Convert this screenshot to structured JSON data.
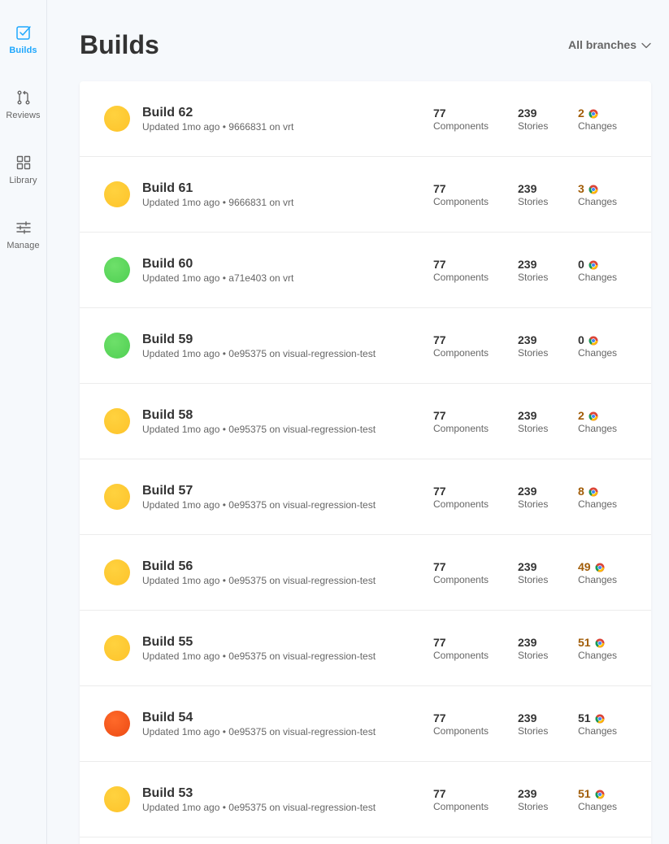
{
  "sidebar": {
    "items": [
      {
        "label": "Builds",
        "icon": "builds-checkbox-icon",
        "active": true
      },
      {
        "label": "Reviews",
        "icon": "pull-request-icon",
        "active": false
      },
      {
        "label": "Library",
        "icon": "grid-icon",
        "active": false
      },
      {
        "label": "Manage",
        "icon": "sliders-icon",
        "active": false
      }
    ]
  },
  "header": {
    "title": "Builds",
    "branch_filter": "All branches"
  },
  "colors": {
    "accent": "#1ea7fd",
    "pending": "#ffc62e",
    "passed": "#5dd35f",
    "failed": "#f4511e",
    "changes_pending": "#a15c07"
  },
  "builds": [
    {
      "name": "Build 62",
      "subtitle": "Updated 1mo ago • 9666831 on vrt",
      "status": "pending",
      "components": "77",
      "components_label": "Components",
      "stories": "239",
      "stories_label": "Stories",
      "changes": "2",
      "changes_label": "Changes",
      "changes_highlight": true
    },
    {
      "name": "Build 61",
      "subtitle": "Updated 1mo ago • 9666831 on vrt",
      "status": "pending",
      "components": "77",
      "components_label": "Components",
      "stories": "239",
      "stories_label": "Stories",
      "changes": "3",
      "changes_label": "Changes",
      "changes_highlight": true
    },
    {
      "name": "Build 60",
      "subtitle": "Updated 1mo ago • a71e403 on vrt",
      "status": "passed",
      "components": "77",
      "components_label": "Components",
      "stories": "239",
      "stories_label": "Stories",
      "changes": "0",
      "changes_label": "Changes",
      "changes_highlight": false
    },
    {
      "name": "Build 59",
      "subtitle": "Updated 1mo ago • 0e95375 on visual-regression-test",
      "status": "passed",
      "components": "77",
      "components_label": "Components",
      "stories": "239",
      "stories_label": "Stories",
      "changes": "0",
      "changes_label": "Changes",
      "changes_highlight": false
    },
    {
      "name": "Build 58",
      "subtitle": "Updated 1mo ago • 0e95375 on visual-regression-test",
      "status": "pending",
      "components": "77",
      "components_label": "Components",
      "stories": "239",
      "stories_label": "Stories",
      "changes": "2",
      "changes_label": "Changes",
      "changes_highlight": true
    },
    {
      "name": "Build 57",
      "subtitle": "Updated 1mo ago • 0e95375 on visual-regression-test",
      "status": "pending",
      "components": "77",
      "components_label": "Components",
      "stories": "239",
      "stories_label": "Stories",
      "changes": "8",
      "changes_label": "Changes",
      "changes_highlight": true
    },
    {
      "name": "Build 56",
      "subtitle": "Updated 1mo ago • 0e95375 on visual-regression-test",
      "status": "pending",
      "components": "77",
      "components_label": "Components",
      "stories": "239",
      "stories_label": "Stories",
      "changes": "49",
      "changes_label": "Changes",
      "changes_highlight": true
    },
    {
      "name": "Build 55",
      "subtitle": "Updated 1mo ago • 0e95375 on visual-regression-test",
      "status": "pending",
      "components": "77",
      "components_label": "Components",
      "stories": "239",
      "stories_label": "Stories",
      "changes": "51",
      "changes_label": "Changes",
      "changes_highlight": true
    },
    {
      "name": "Build 54",
      "subtitle": "Updated 1mo ago • 0e95375 on visual-regression-test",
      "status": "failed",
      "components": "77",
      "components_label": "Components",
      "stories": "239",
      "stories_label": "Stories",
      "changes": "51",
      "changes_label": "Changes",
      "changes_highlight": false
    },
    {
      "name": "Build 53",
      "subtitle": "Updated 1mo ago • 0e95375 on visual-regression-test",
      "status": "pending",
      "components": "77",
      "components_label": "Components",
      "stories": "239",
      "stories_label": "Stories",
      "changes": "51",
      "changes_label": "Changes",
      "changes_highlight": true
    }
  ]
}
